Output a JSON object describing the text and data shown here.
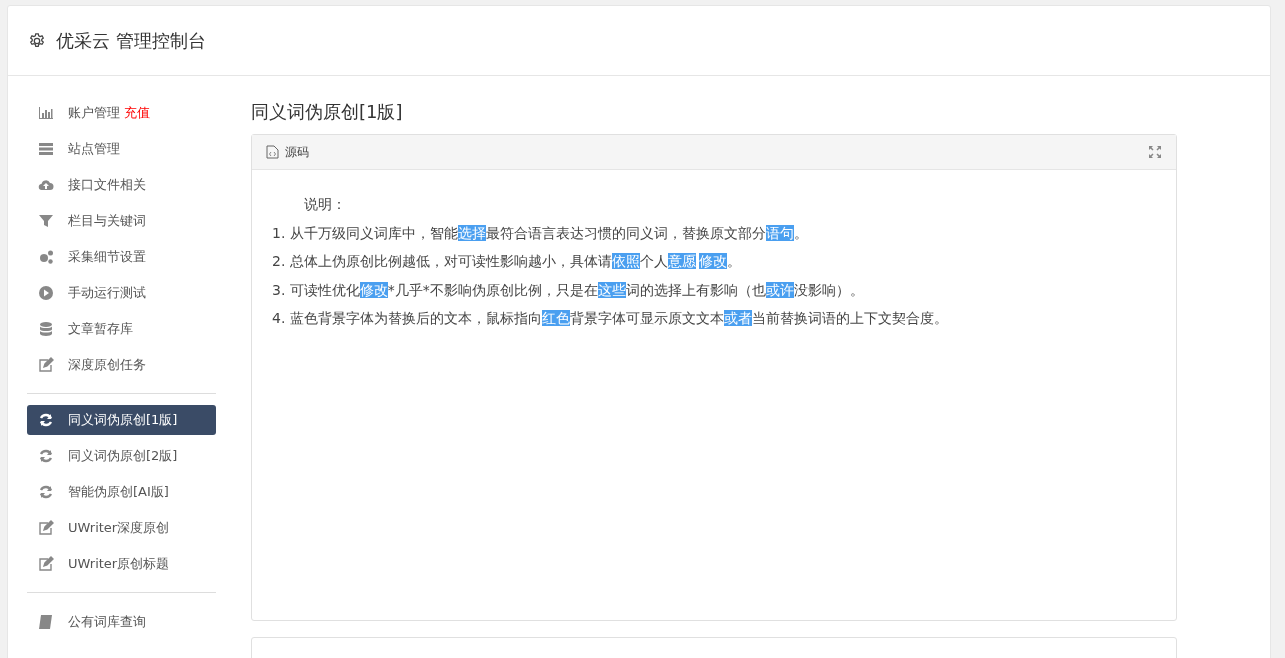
{
  "header": {
    "title": "优采云 管理控制台"
  },
  "sidebar": {
    "groups": [
      {
        "items": [
          {
            "label": "账户管理",
            "badge": "充值",
            "selected": false
          },
          {
            "label": "站点管理",
            "selected": false
          },
          {
            "label": "接口文件相关",
            "selected": false
          },
          {
            "label": "栏目与关键词",
            "selected": false
          },
          {
            "label": "采集细节设置",
            "selected": false
          },
          {
            "label": "手动运行测试",
            "selected": false
          },
          {
            "label": "文章暂存库",
            "selected": false
          },
          {
            "label": "深度原创任务",
            "selected": false
          }
        ]
      },
      {
        "items": [
          {
            "label": "同义词伪原创[1版]",
            "selected": true
          },
          {
            "label": "同义词伪原创[2版]",
            "selected": false
          },
          {
            "label": "智能伪原创[AI版]",
            "selected": false
          },
          {
            "label": "UWriter深度原创",
            "selected": false
          },
          {
            "label": "UWriter原创标题",
            "selected": false
          }
        ]
      },
      {
        "items": [
          {
            "label": "公有词库查询",
            "selected": false
          }
        ]
      }
    ]
  },
  "page": {
    "title": "同义词伪原创[1版]",
    "editor": {
      "tab": "源码",
      "heading": "说明：",
      "lines": [
        [
          {
            "text": "1. 从千万级同义词库中，智能",
            "highlighted": false
          },
          {
            "text": "选择",
            "highlighted": true
          },
          {
            "text": "最符合语言表达习惯的同义词，替换原文部分",
            "highlighted": false
          },
          {
            "text": "语句",
            "highlighted": true
          },
          {
            "text": "。",
            "highlighted": false
          }
        ],
        [
          {
            "text": "2. 总体上伪原创比例越低，对可读性影响越小，具体请",
            "highlighted": false
          },
          {
            "text": "依照",
            "highlighted": true
          },
          {
            "text": "个人",
            "highlighted": false
          },
          {
            "text": "意愿",
            "highlighted": true
          },
          {
            "text": "修改",
            "highlighted": true
          },
          {
            "text": "。",
            "highlighted": false
          }
        ],
        [
          {
            "text": "3. 可读性优化",
            "highlighted": false
          },
          {
            "text": "修改",
            "highlighted": true
          },
          {
            "text": "*几乎*不影响伪原创比例，只是在",
            "highlighted": false
          },
          {
            "text": "这些",
            "highlighted": true
          },
          {
            "text": "词的选择上有影响（也",
            "highlighted": false
          },
          {
            "text": "或许",
            "highlighted": true
          },
          {
            "text": "没影响）。",
            "highlighted": false
          }
        ],
        [
          {
            "text": "4. 蓝色背景字体为替换后的文本，鼠标指向",
            "highlighted": false
          },
          {
            "text": "红色",
            "highlighted": true
          },
          {
            "text": "背景字体可显示原文文本",
            "highlighted": false
          },
          {
            "text": "或者",
            "highlighted": true
          },
          {
            "text": "当前替换词语的上下文契合度。",
            "highlighted": false
          }
        ]
      ]
    }
  }
}
